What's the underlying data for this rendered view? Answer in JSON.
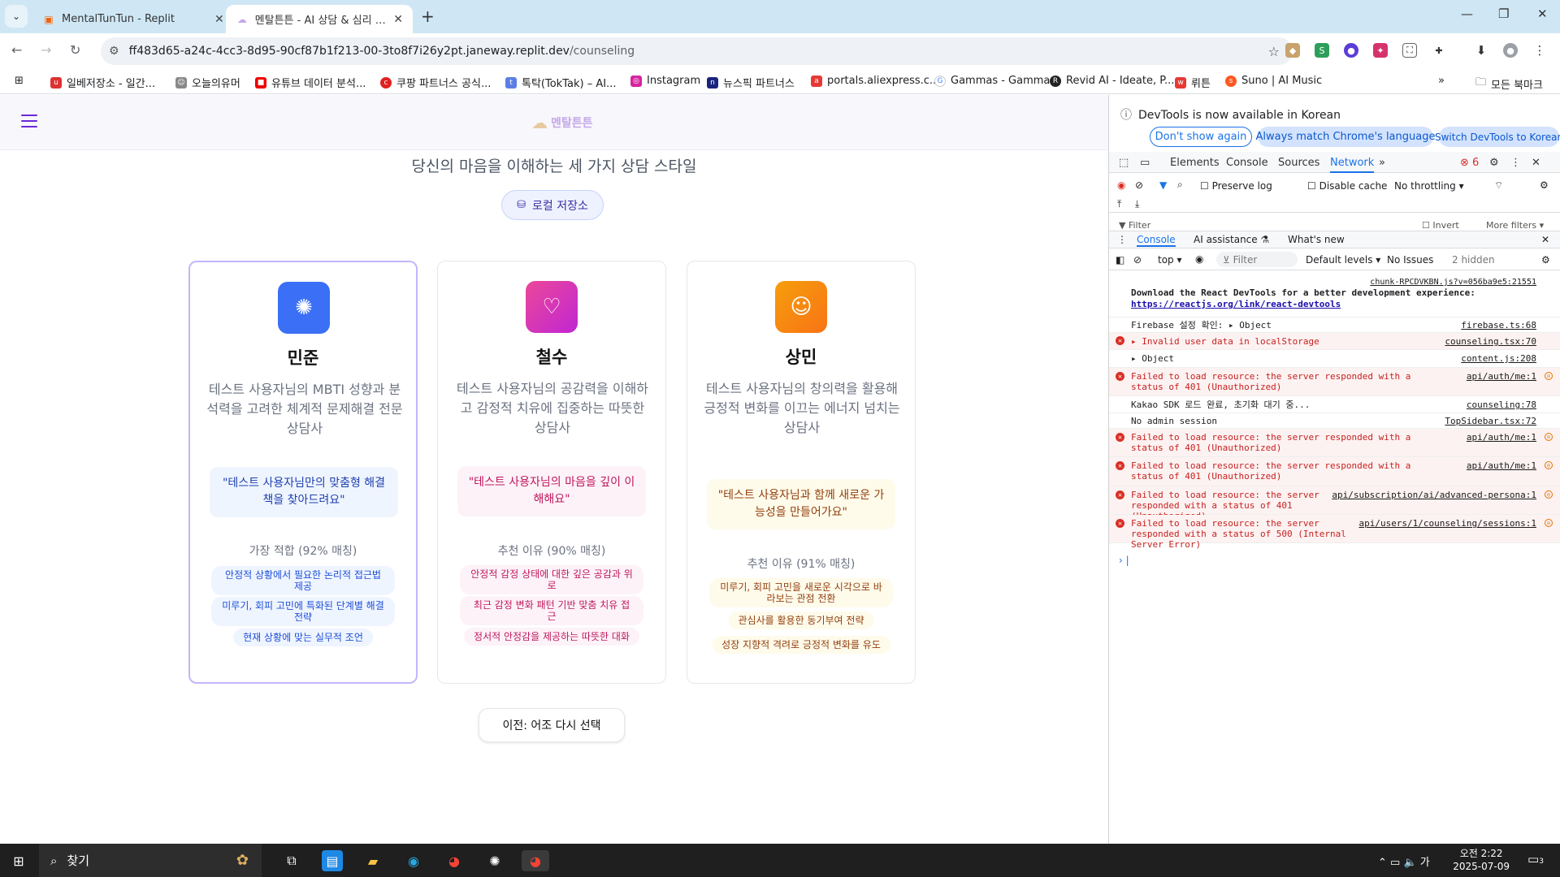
{
  "browser": {
    "tabs": [
      {
        "title": "MentalTunTun - Replit",
        "active": false
      },
      {
        "title": "멘탈튼튼 - AI 상담 & 심리 분석",
        "active": true
      }
    ],
    "url_host": "ff483d65-a24c-4cc3-8d95-90cf87b1f213-00-3to8f7i26y2pt.janeway.replit.dev",
    "url_path": "/counseling",
    "bookmarks": [
      "일베저장소 - 일간...",
      "오늘의유머",
      "유튜브 데이터 분석...",
      "쿠팡 파트너스 공식...",
      "톡탁(TokTak) – AI...",
      "Instagram",
      "뉴스픽 파트너스",
      "portals.aliexpress.c...",
      "Gammas - Gamma",
      "Revid AI - Ideate, P...",
      "뤼튼",
      "Suno | AI Music"
    ],
    "bookmarks_folder": "모든 북마크"
  },
  "app": {
    "logo_text": "멘탈튼튼",
    "subtitle": "당신의 마음을 이해하는 세 가지 상담 스타일",
    "local_storage_label": "로컬 저장소",
    "cards": [
      {
        "name": "민준",
        "desc": "테스트 사용자님의 MBTI 성향과 분석력을 고려한 체계적 문제해결 전문 상담사",
        "quote": "\"테스트 사용자님만의 맞춤형 해결책을 찾아드려요\"",
        "match": "가장 적합 (92% 매칭)",
        "chips": [
          "안정적 상황에서 필요한 논리적 접근법 제공",
          "미루기, 회피 고민에 특화된 단계별 해결 전략",
          "현재 상황에 맞는 실무적 조언"
        ],
        "accent": "#3b6ff6",
        "selected": true
      },
      {
        "name": "철수",
        "desc": "테스트 사용자님의 공감력을 이해하고 감정적 치유에 집중하는 따뜻한 상담사",
        "quote": "\"테스트 사용자님의 마음을 깊이 이해해요\"",
        "match": "추천 이유 (90% 매칭)",
        "chips": [
          "안정적 감정 상태에 대한 깊은 공감과 위로",
          "최근 감정 변화 패턴 기반 맞춤 치유 접근",
          "정서적 안정감을 제공하는 따뜻한 대화"
        ],
        "accent": "#e94aa0",
        "selected": false
      },
      {
        "name": "상민",
        "desc": "테스트 사용자님의 창의력을 활용해 긍정적 변화를 이끄는 에너지 넘치는 상담사",
        "quote": "\"테스트 사용자님과 함께 새로운 가능성을 만들어가요\"",
        "match": "추천 이유 (91% 매칭)",
        "chips": [
          "미루기, 회피 고민을 새로운 시각으로 바라보는 관점 전환",
          "관심사를 활용한 동기부여 전략",
          "성장 지향적 격려로 긍정적 변화를 유도"
        ],
        "accent": "#f59e0b",
        "selected": false
      }
    ],
    "back_button": "이전: 어조 다시 선택"
  },
  "devtools": {
    "info_msg": "DevTools is now available in Korean",
    "info_buttons": [
      "Don't show again",
      "Always match Chrome's language",
      "Switch DevTools to Korean"
    ],
    "tabs": [
      "Elements",
      "Console",
      "Sources",
      "Network"
    ],
    "active_tab": "Network",
    "error_count": "6",
    "preserve_log": "Preserve log",
    "disable_cache": "Disable cache",
    "throttling": "No throttling",
    "filter_label": "Filter",
    "invert_label": "Invert",
    "more_filters": "More filters",
    "drawer_tabs": [
      "Console",
      "AI assistance",
      "What's new"
    ],
    "console_context": "top",
    "console_filter": "Filter",
    "default_levels": "Default levels",
    "no_issues": "No Issues",
    "hidden": "2 hidden",
    "logs": [
      {
        "type": "info",
        "text": "Download the React DevTools for a better development experience:",
        "link": "https://reactjs.org/link/react-devtools",
        "src": "chunk-RPCDVKBN.js?v=056ba9e5:21551"
      },
      {
        "type": "info",
        "text": "Firebase 설정 확인: ▸ Object",
        "src": "firebase.ts:68"
      },
      {
        "type": "error",
        "text": "▸ Invalid user data in localStorage",
        "src": "counseling.tsx:70"
      },
      {
        "type": "info",
        "text": "  ▸ Object",
        "src": "content.js:208"
      },
      {
        "type": "error",
        "text": "Failed to load resource: the server responded with a status of 401 (Unauthorized)",
        "src": "api/auth/me:1"
      },
      {
        "type": "info",
        "text": "Kakao SDK 로드 완료, 초기화 대기 중...",
        "src": "counseling:78"
      },
      {
        "type": "info",
        "text": "No admin session",
        "src": "TopSidebar.tsx:72"
      },
      {
        "type": "error",
        "text": "Failed to load resource: the server responded with a status of 401 (Unauthorized)",
        "src": "api/auth/me:1"
      },
      {
        "type": "error",
        "text": "Failed to load resource: the server responded with a status of 401 (Unauthorized)",
        "src": "api/auth/me:1"
      },
      {
        "type": "error",
        "text": "Failed to load resource: the server responded with a status of 401 (Unauthorized)",
        "src": "api/subscription/ai/advanced-persona:1"
      },
      {
        "type": "error",
        "text": "Failed to load resource: the server responded with a status of 500 (Internal Server Error)",
        "src": "api/users/1/counseling/sessions:1"
      }
    ]
  },
  "taskbar": {
    "search_label": "찾기",
    "time": "오전 2:22",
    "date": "2025-07-09",
    "ime": "가",
    "notif_count": "3"
  }
}
